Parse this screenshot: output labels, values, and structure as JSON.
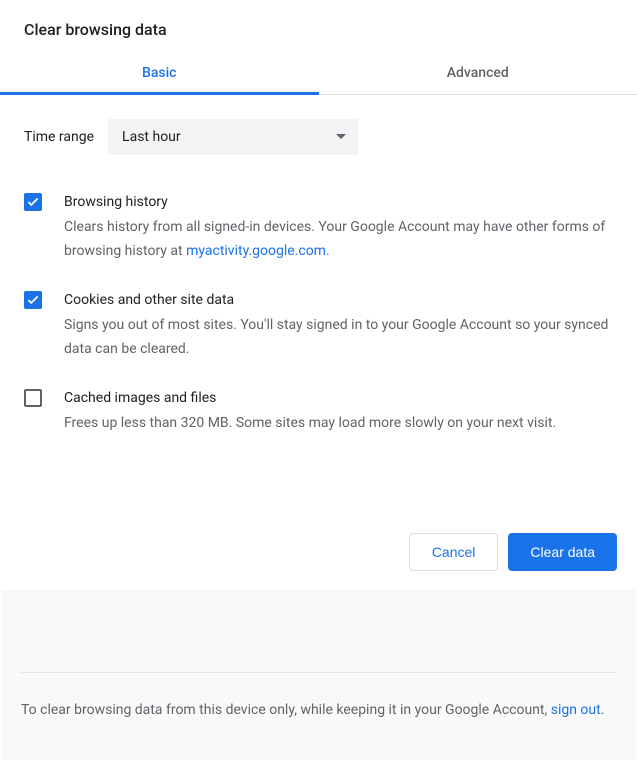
{
  "title": "Clear browsing data",
  "tabs": {
    "basic": "Basic",
    "advanced": "Advanced"
  },
  "time_range": {
    "label": "Time range",
    "value": "Last hour"
  },
  "options": [
    {
      "checked": true,
      "title": "Browsing history",
      "desc_pre": "Clears history from all signed-in devices. Your Google Account may have other forms of browsing history at ",
      "desc_link": "myactivity.google.com",
      "desc_post": "."
    },
    {
      "checked": true,
      "title": "Cookies and other site data",
      "desc": "Signs you out of most sites. You'll stay signed in to your Google Account so your synced data can be cleared."
    },
    {
      "checked": false,
      "title": "Cached images and files",
      "desc": "Frees up less than 320 MB. Some sites may load more slowly on your next visit."
    }
  ],
  "buttons": {
    "cancel": "Cancel",
    "clear": "Clear data"
  },
  "footer": {
    "pre": "To clear browsing data from this device only, while keeping it in your Google Account, ",
    "link": "sign out",
    "post": "."
  }
}
